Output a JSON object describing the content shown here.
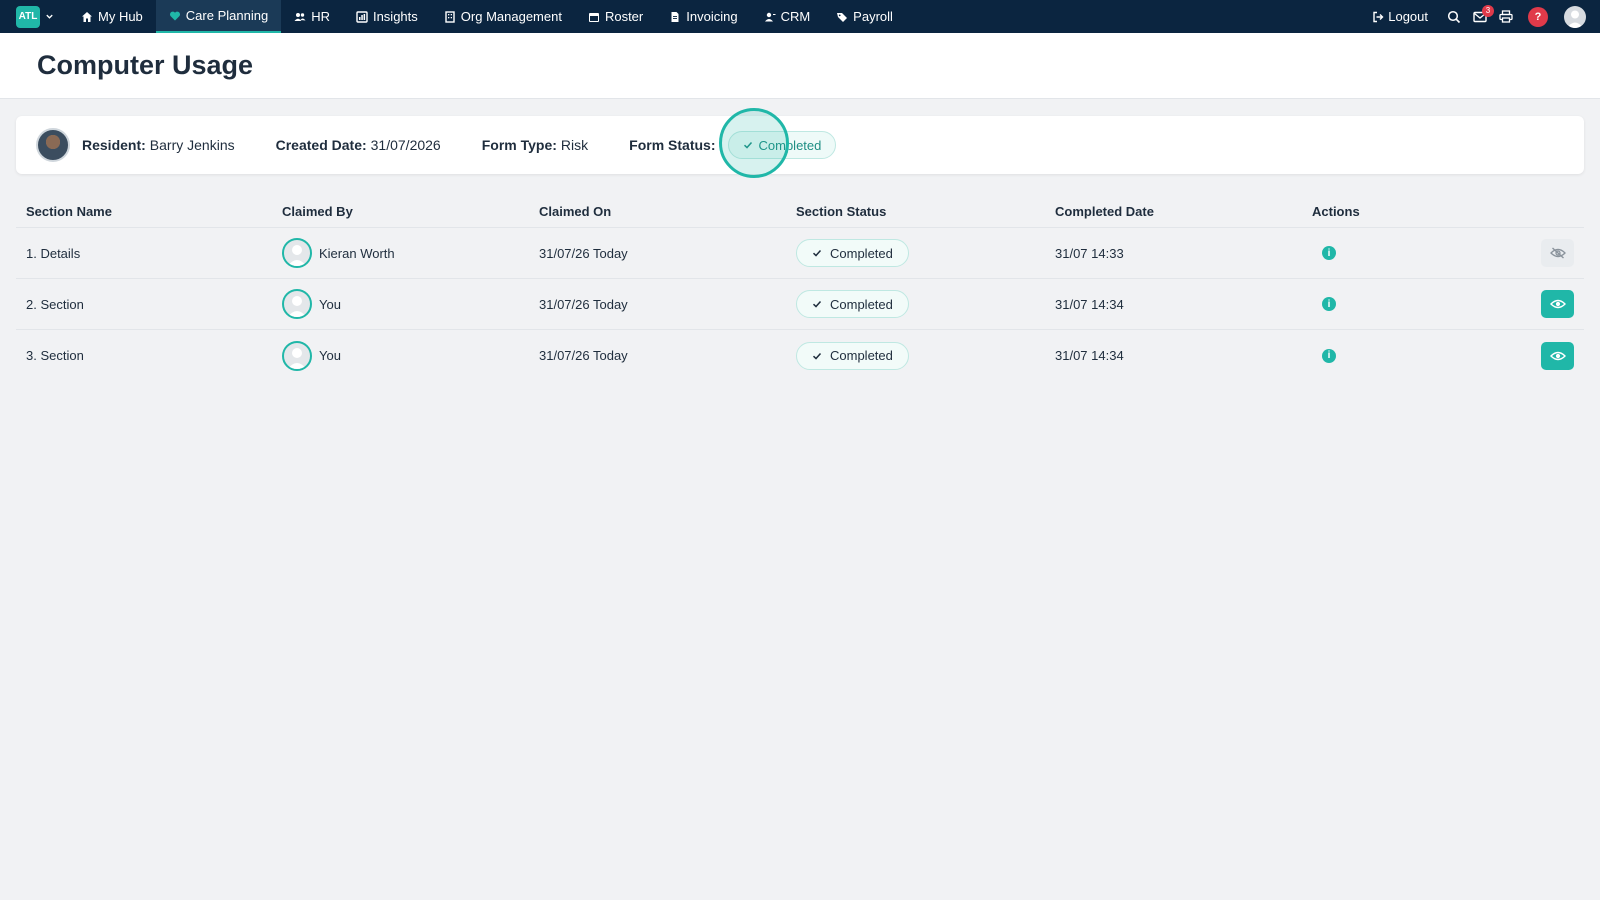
{
  "colors": {
    "nav_bg": "#0b2540",
    "accent": "#20b7a8",
    "alert": "#e03a4a"
  },
  "nav": {
    "org_logo": "ATL",
    "items": [
      {
        "label": "My Hub",
        "icon": "home-icon"
      },
      {
        "label": "Care Planning",
        "icon": "heart-icon",
        "active": true
      },
      {
        "label": "HR",
        "icon": "people-icon"
      },
      {
        "label": "Insights",
        "icon": "chart-icon"
      },
      {
        "label": "Org Management",
        "icon": "building-icon"
      },
      {
        "label": "Roster",
        "icon": "calendar-icon"
      },
      {
        "label": "Invoicing",
        "icon": "document-icon"
      },
      {
        "label": "CRM",
        "icon": "contacts-icon"
      },
      {
        "label": "Payroll",
        "icon": "tag-icon"
      }
    ],
    "logout_label": "Logout",
    "mail_badge": "3",
    "help_label": "?"
  },
  "page": {
    "title": "Computer Usage"
  },
  "info": {
    "resident_label": "Resident:",
    "resident_value": "Barry Jenkins",
    "created_label": "Created Date:",
    "created_value": "31/07/2026",
    "type_label": "Form Type:",
    "type_value": "Risk",
    "status_label": "Form Status:",
    "status_value": "Completed"
  },
  "table": {
    "headers": [
      "Section Name",
      "Claimed By",
      "Claimed On",
      "Section Status",
      "Completed Date",
      "Actions"
    ],
    "rows": [
      {
        "section": "1. Details",
        "claimed_by": "Kieran Worth",
        "claimed_on": "31/07/26 Today",
        "status": "Completed",
        "completed": "31/07 14:33",
        "view_enabled": false
      },
      {
        "section": "2. Section",
        "claimed_by": "You",
        "claimed_on": "31/07/26 Today",
        "status": "Completed",
        "completed": "31/07 14:34",
        "view_enabled": true
      },
      {
        "section": "3. Section",
        "claimed_by": "You",
        "claimed_on": "31/07/26 Today",
        "status": "Completed",
        "completed": "31/07 14:34",
        "view_enabled": true
      }
    ]
  }
}
